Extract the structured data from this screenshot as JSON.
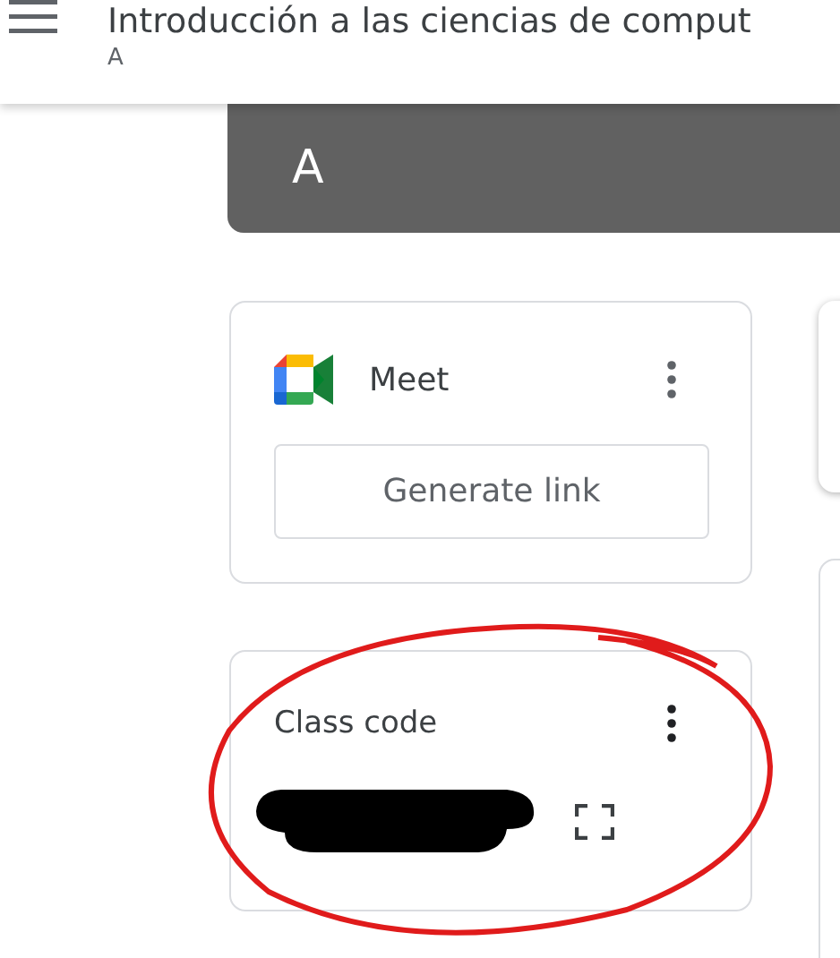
{
  "header": {
    "title": "Introducción a las ciencias de comput",
    "subtitle": "A"
  },
  "banner": {
    "initial": "A"
  },
  "meet_card": {
    "title": "Meet",
    "button": "Generate link"
  },
  "class_code_card": {
    "title": "Class code"
  }
}
